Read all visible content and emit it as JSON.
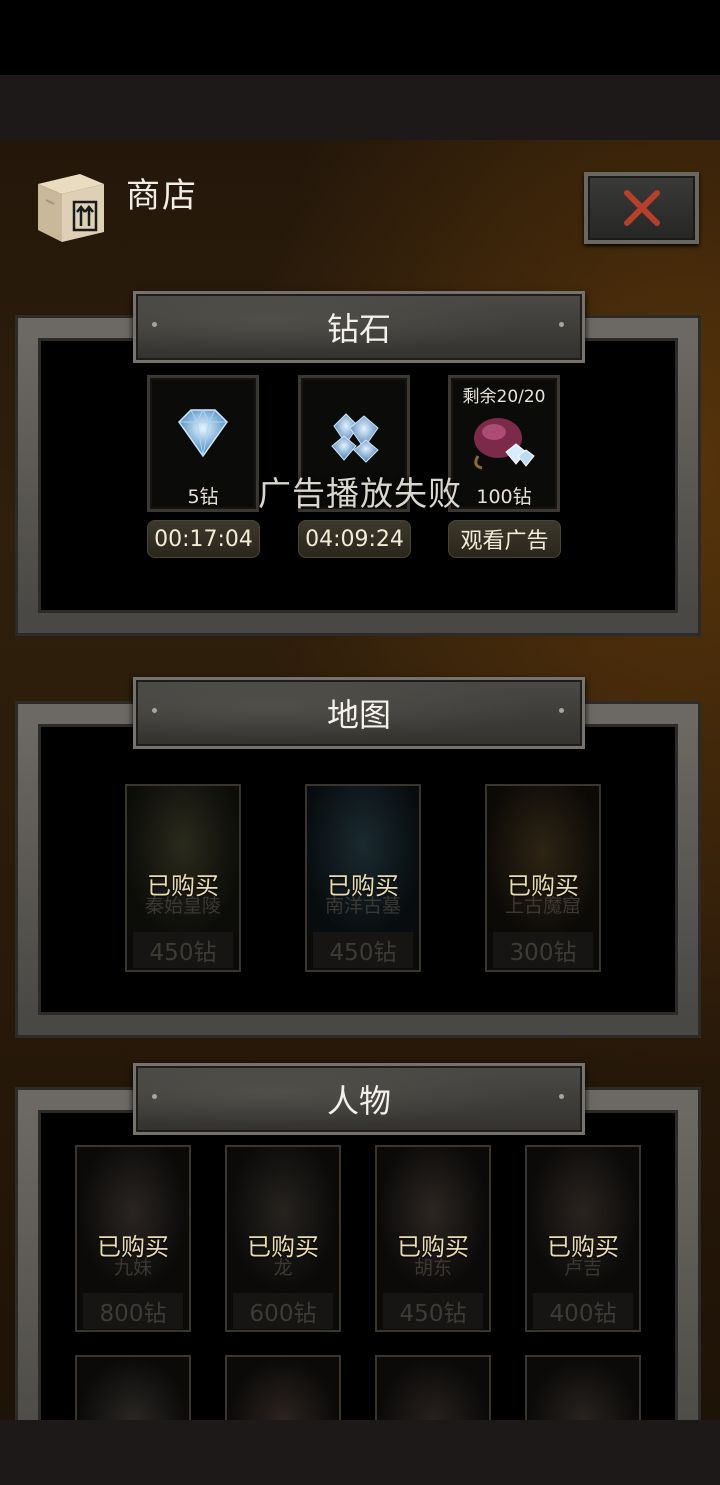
{
  "shop": {
    "title": "商店",
    "close_icon": "close-x-icon"
  },
  "diamonds": {
    "header": "钻石",
    "items": [
      {
        "label": "5钻",
        "timer": "00:17:04",
        "icon": "single-diamond-icon"
      },
      {
        "label": "",
        "timer": "04:09:24",
        "icon": "diamond-pile-icon"
      },
      {
        "label": "100钻",
        "remaining": "剩余20/20",
        "button": "观看广告",
        "icon": "diamond-bag-icon"
      }
    ],
    "toast": "广告播放失败"
  },
  "maps": {
    "header": "地图",
    "items": [
      {
        "status": "已购买",
        "name": "秦始皇陵",
        "price": "450钻"
      },
      {
        "status": "已购买",
        "name": "南洋古墓",
        "price": "450钻"
      },
      {
        "status": "已购买",
        "name": "上古魔窟",
        "price": "300钻"
      }
    ]
  },
  "characters": {
    "header": "人物",
    "items": [
      {
        "status": "已购买",
        "name": "九妹",
        "price": "800钻"
      },
      {
        "status": "已购买",
        "name": "龙",
        "price": "600钻"
      },
      {
        "status": "已购买",
        "name": "胡东",
        "price": "450钻"
      },
      {
        "status": "已购买",
        "name": "卢吉",
        "price": "400钻"
      }
    ]
  },
  "colors": {
    "accent_red": "#b5402c",
    "gold_text": "#e9dcb2",
    "panel_frame": "#575550"
  }
}
